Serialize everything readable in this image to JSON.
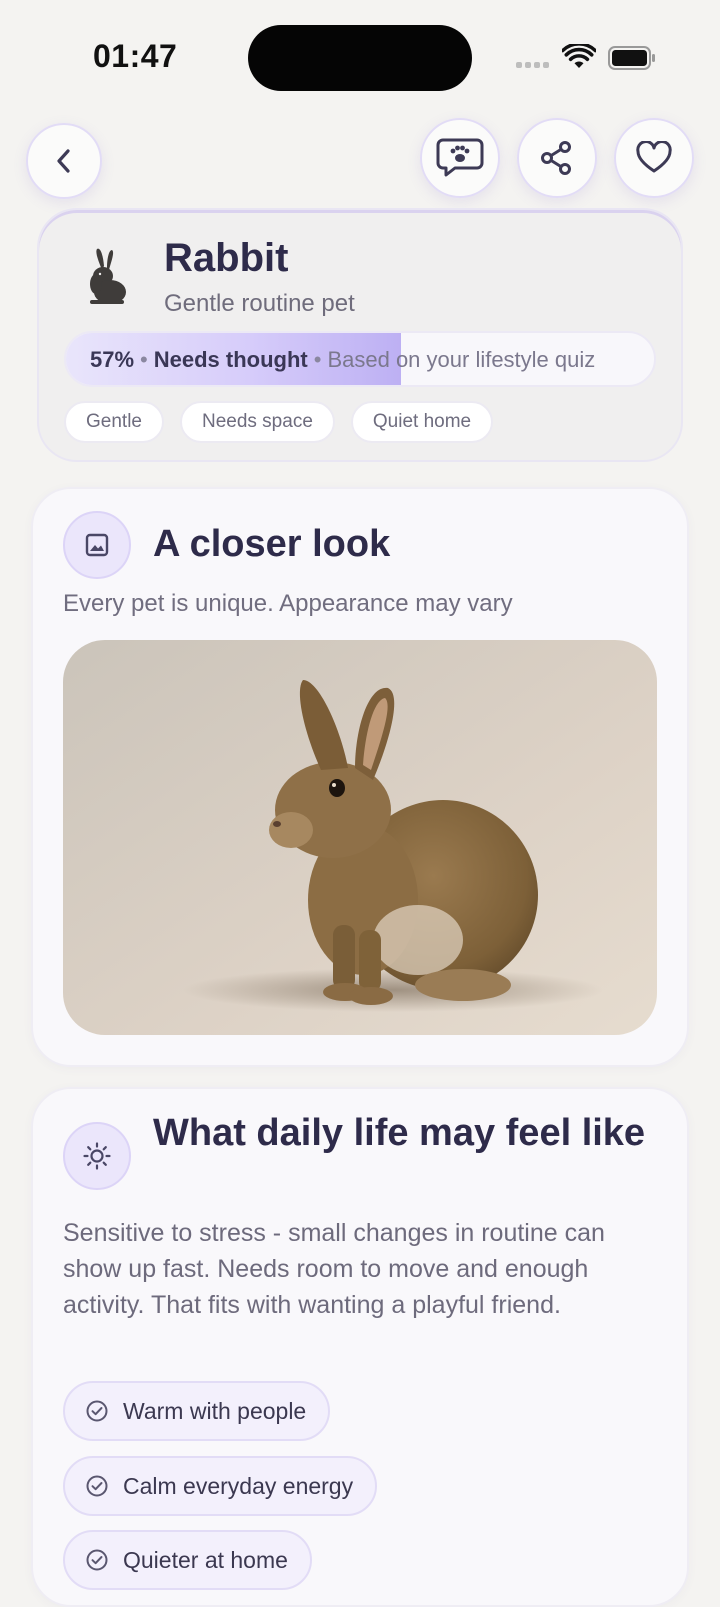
{
  "status": {
    "time": "01:47"
  },
  "nav": {
    "back_icon": "chevron-left-icon",
    "chat_icon": "paw-chat-icon",
    "share_icon": "share-icon",
    "favorite_icon": "heart-icon"
  },
  "pet": {
    "name": "Rabbit",
    "subtitle": "Gentle routine pet",
    "icon": "rabbit-icon",
    "match": {
      "percent_label": "57%",
      "percent": 57,
      "verdict": "Needs thought",
      "basis": "Based on your lifestyle quiz"
    },
    "tags": [
      "Gentle",
      "Needs space",
      "Quiet home"
    ]
  },
  "closer_look": {
    "title": "A closer look",
    "subtitle": "Every pet is unique. Appearance may vary",
    "icon": "image-icon"
  },
  "daily_life": {
    "title": "What daily life may feel like",
    "description": "Sensitive to stress - small changes in routine can show up fast. Needs room to move and enough activity. That fits with wanting a playful friend.",
    "icon": "sun-icon",
    "traits": [
      {
        "label": "Warm with people",
        "icon": "check-circle-icon"
      },
      {
        "label": "Calm everyday energy",
        "icon": "check-circle-icon"
      },
      {
        "label": "Quieter at home",
        "icon": "check-circle-icon"
      }
    ]
  },
  "colors": {
    "accent": "#bdb0f3",
    "accent_border": "#e2dcf6",
    "heading": "#2e2b4a",
    "background": "#f4f3f1"
  }
}
